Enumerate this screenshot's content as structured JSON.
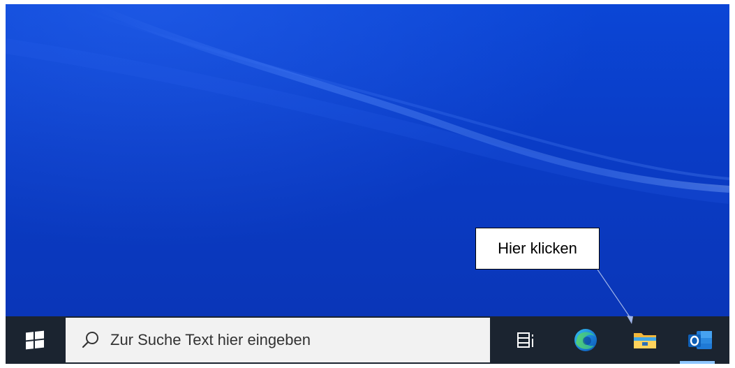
{
  "taskbar": {
    "search_placeholder": "Zur Suche Text hier eingeben",
    "icons": [
      "windows-start-icon",
      "search-icon",
      "task-view-icon",
      "edge-icon",
      "file-explorer-icon",
      "outlook-icon"
    ]
  },
  "annotation": {
    "callout_text": "Hier klicken"
  },
  "colors": {
    "desktop": "#0a3fc7",
    "taskbar": "#1b2430",
    "search_box": "#f2f2f2",
    "active_indicator": "#8ec6ff",
    "arrow": "#9fb4e8"
  }
}
